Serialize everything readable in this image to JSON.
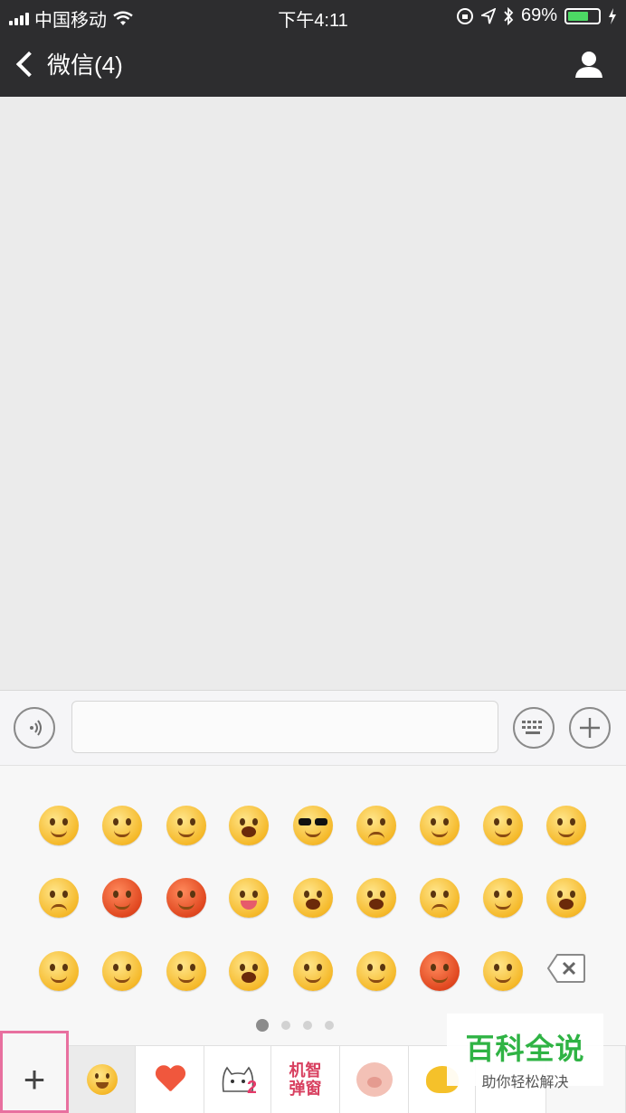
{
  "status_bar": {
    "carrier": "中国移动",
    "time": "下午4:11",
    "battery_percent": "69%",
    "battery_level": 0.69,
    "icons": [
      "signal-icon",
      "wifi-icon",
      "orientation-lock-icon",
      "location-icon",
      "bluetooth-icon",
      "battery-icon",
      "charging-icon"
    ]
  },
  "nav": {
    "back_label": "微信(4)",
    "icons": [
      "back-chevron-icon",
      "user-profile-icon"
    ]
  },
  "input_bar": {
    "text_value": "",
    "icons": [
      "voice-icon",
      "keyboard-icon",
      "plus-icon"
    ]
  },
  "emoji_panel": {
    "rows": [
      [
        "smile",
        "awkward",
        "heart-eyes",
        "staring",
        "cool",
        "crying",
        "shy",
        "silent",
        "sleepy"
      ],
      [
        "sob",
        "embarrassed",
        "angry",
        "wink",
        "grin",
        "surprised",
        "sad",
        "flushed",
        "laugh-tears"
      ],
      [
        "sick",
        "cover-mouth",
        "blush",
        "shocked",
        "confused",
        "blank",
        "scold",
        "awkward-sweat",
        "delete"
      ]
    ],
    "page_count": 4,
    "active_page": 1
  },
  "tabs": [
    {
      "name": "add",
      "label": "+"
    },
    {
      "name": "emoji",
      "label": ""
    },
    {
      "name": "favorites",
      "label": ""
    },
    {
      "name": "cat-sticker",
      "label": ""
    },
    {
      "name": "text-sticker",
      "label_line1": "机智",
      "label_line2": "弹窗"
    },
    {
      "name": "pig-sticker",
      "label": ""
    },
    {
      "name": "chick-sticker",
      "label": ""
    },
    {
      "name": "more-sticker",
      "label": ""
    },
    {
      "name": "settings",
      "label": ""
    }
  ],
  "watermark": {
    "title": "百科全说",
    "subtitle": "助你轻松解决"
  }
}
